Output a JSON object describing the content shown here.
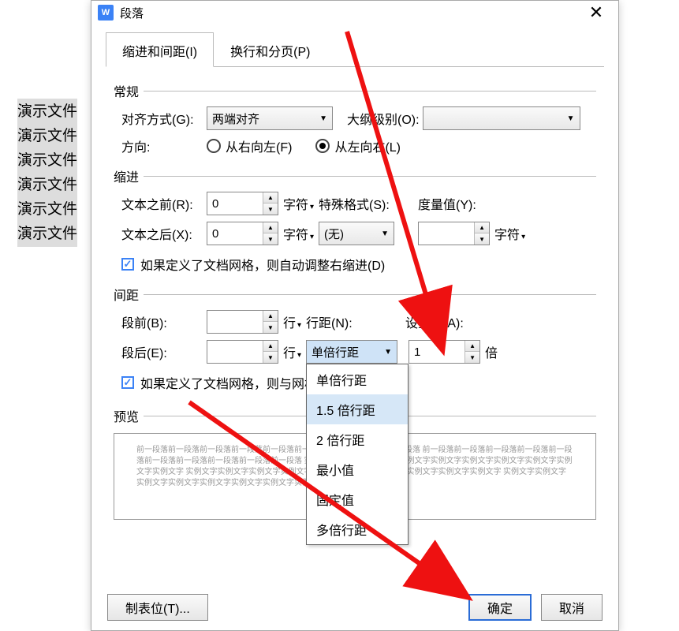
{
  "bg": {
    "lines": [
      "演示文件",
      "演示文件",
      "演示文件",
      "演示文件",
      "演示文件",
      "演示文件"
    ]
  },
  "dialog": {
    "app_icon_text": "W",
    "title": "段落",
    "close_glyph": "✕",
    "tabs": [
      {
        "label": "缩进和间距(I)",
        "active": true
      },
      {
        "label": "换行和分页(P)",
        "active": false
      }
    ],
    "sections": {
      "general": {
        "title": "常规",
        "align_label": "对齐方式(G):",
        "align_value": "两端对齐",
        "outline_label": "大纲级别(O):",
        "outline_value": "",
        "direction_label": "方向:",
        "rtl_label": "从右向左(F)",
        "ltr_label": "从左向右(L)"
      },
      "indent": {
        "title": "缩进",
        "before_label": "文本之前(R):",
        "before_value": "0",
        "after_label": "文本之后(X):",
        "after_value": "0",
        "unit_char": "字符",
        "special_label": "特殊格式(S):",
        "special_value": "(无)",
        "measure_label": "度量值(Y):",
        "measure_value": "",
        "measure_unit": "字符",
        "grid_checkbox": "如果定义了文档网格，则自动调整右缩进(D)"
      },
      "spacing": {
        "title": "间距",
        "before_label": "段前(B):",
        "before_value": "",
        "before_unit": "行",
        "after_label": "段后(E):",
        "after_value": "",
        "after_unit": "行",
        "linespacing_label": "行距(N):",
        "linespacing_value": "单倍行距",
        "linespacing_options": [
          "单倍行距",
          "1.5 倍行距",
          "2 倍行距",
          "最小值",
          "固定值",
          "多倍行距"
        ],
        "linespacing_hover_index": 1,
        "setvalue_label": "设置值(A):",
        "setvalue_value": "1",
        "setvalue_unit": "倍",
        "grid_checkbox": "如果定义了文档网格，则与网格对"
      },
      "preview": {
        "title": "预览",
        "text": "前一段落前一段落前一段落前一段落前一段落前一段落前一段落前一段落前一段落\n前一段落前一段落前一段落前一段落前一段落前一段落前一段落前一段落前一段落前一段落\n实例文字实例文字实例文字实例文字实例文字实例文字实例文字实例文字实例文字实例文字\n实例文字实例文字实例文字实例文字实例文字实例文字实例文字实例文字实例文字实例文字\n实例文字实例文字实例文字实例文字实例文字实例文字实例文字实例文字实例文字实例文字"
      }
    },
    "footer": {
      "tabstops": "制表位(T)...",
      "ok": "确定",
      "cancel": "取消"
    }
  }
}
